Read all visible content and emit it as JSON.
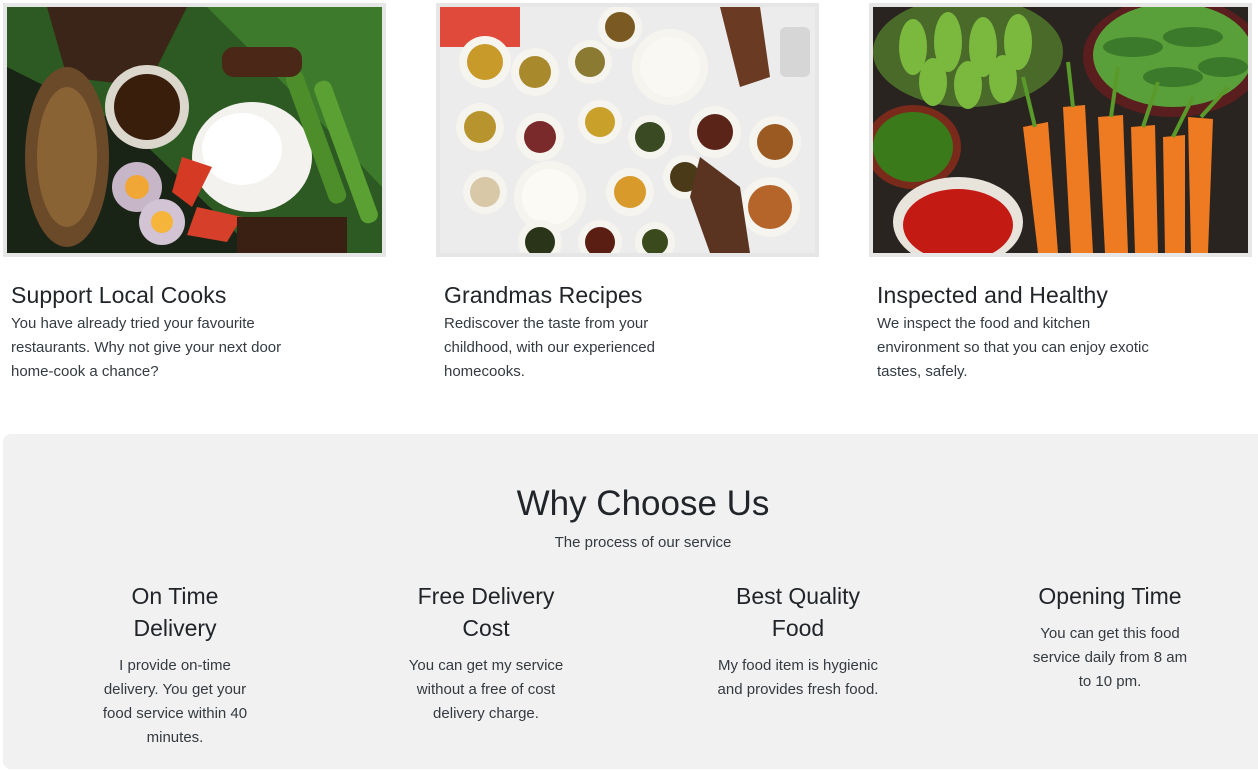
{
  "features": [
    {
      "title": "Support Local Cooks",
      "text": "You have already tried your favourite restaurants. Why not give your next door home-cook a chance?"
    },
    {
      "title": "Grandmas Recipes",
      "text": "Rediscover the taste from your childhood, with our experienced homecooks."
    },
    {
      "title": "Inspected and Healthy",
      "text": "We inspect the food and kitchen environment so that you can enjoy exotic tastes, safely."
    }
  ],
  "why": {
    "title": "Why Choose Us",
    "subtitle": "The process of our service",
    "services": [
      {
        "title": "On Time Delivery",
        "text": "I provide on-time delivery. You get your food service within 40 minutes."
      },
      {
        "title": "Free Delivery Cost",
        "text": "You can get my service without a free of cost delivery charge."
      },
      {
        "title": "Best Quality Food",
        "text": "My food item is hygienic and provides fresh food."
      },
      {
        "title": "Opening Time",
        "text": "You can get this food service daily from 8 am to 10 pm."
      }
    ]
  },
  "colors": {
    "section_bg": "#f1f1f1",
    "heading": "#212529",
    "body_text": "#343a40",
    "photo_border": "#e6e6e6"
  }
}
